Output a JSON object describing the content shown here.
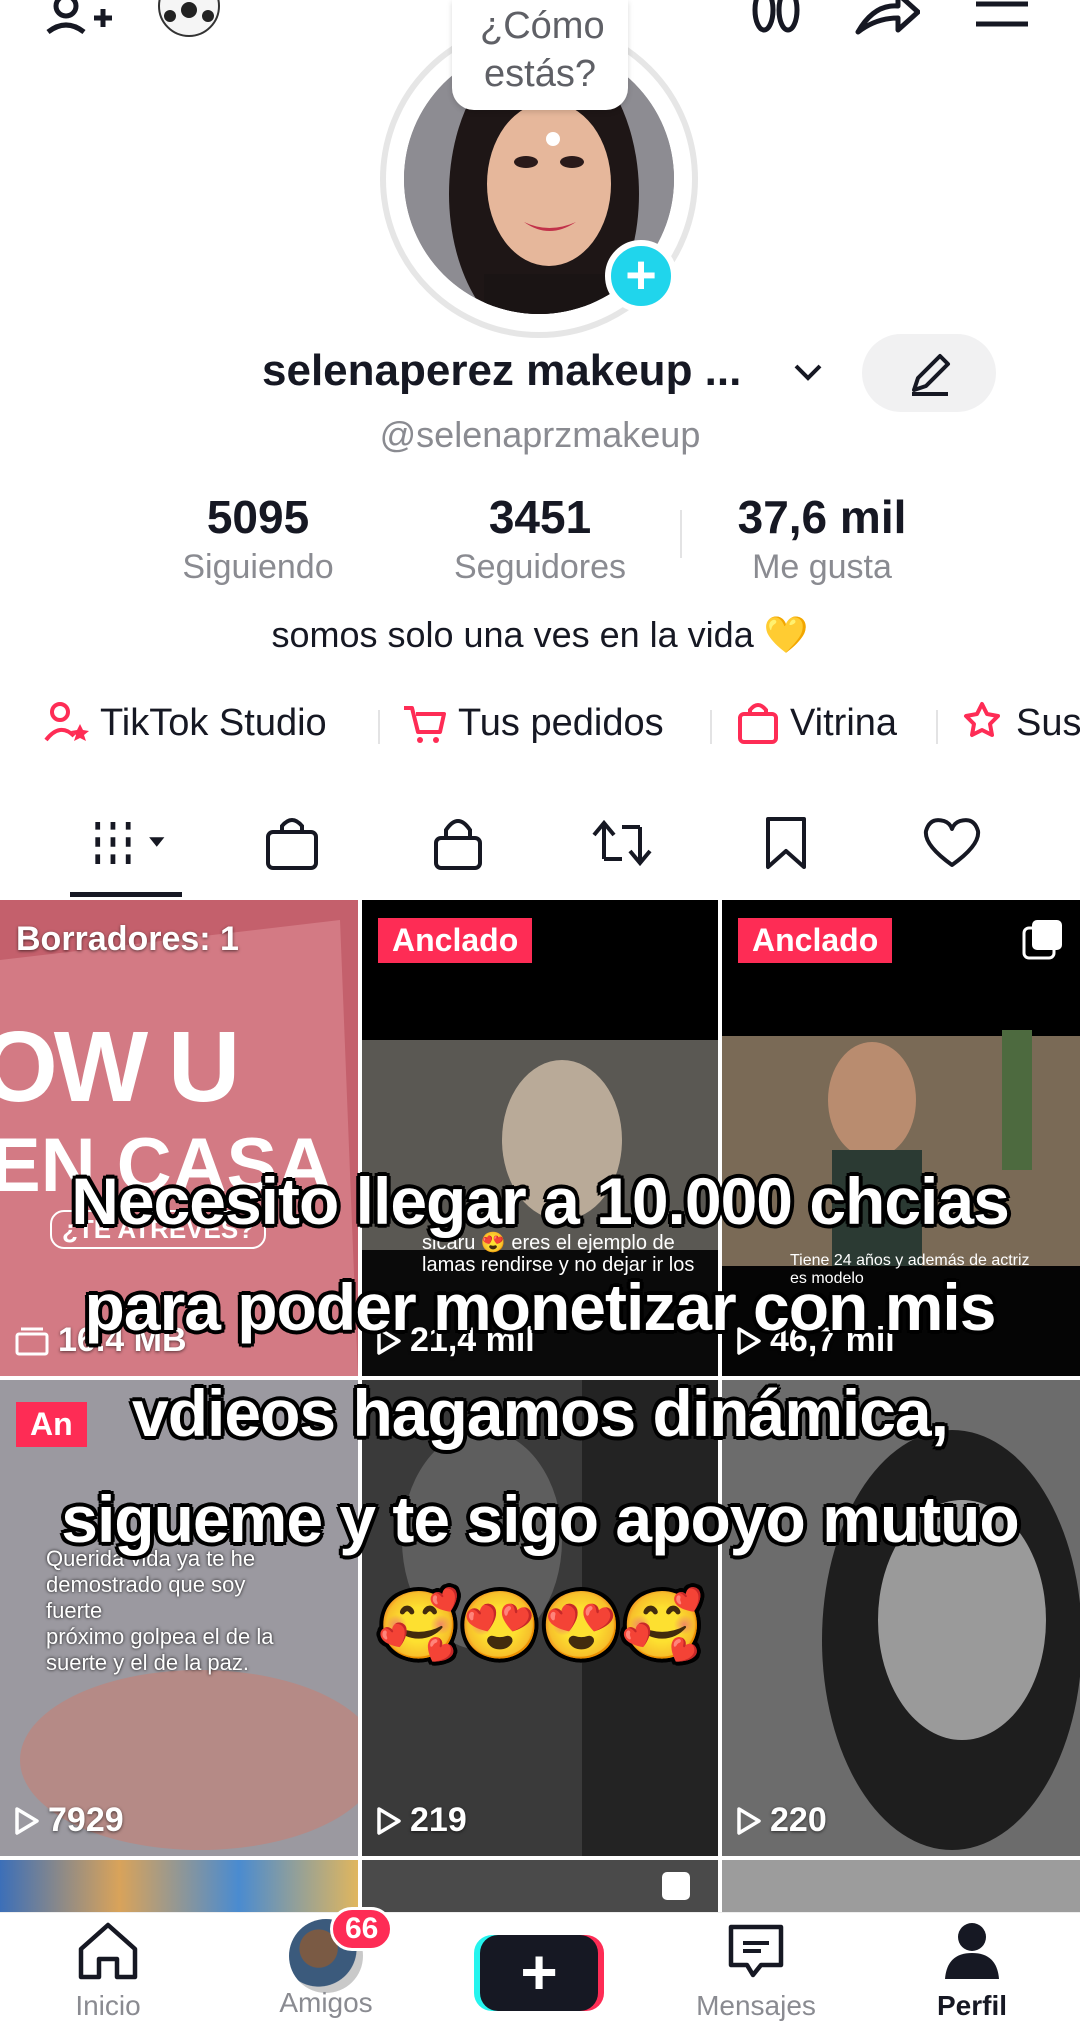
{
  "top_bar": {
    "left_icons": [
      "add-friend-icon",
      "soccer-ball-icon"
    ],
    "right_icons": [
      "footprints-icon",
      "share-icon",
      "menu-icon"
    ]
  },
  "profile": {
    "status_bubble": "¿Cómo estás?",
    "display_name": "selenaperez makeup ...",
    "handle": "@selenaprzmakeup",
    "stats": [
      {
        "value": "5095",
        "label": "Siguiendo"
      },
      {
        "value": "3451",
        "label": "Seguidores"
      },
      {
        "value": "37,6 mil",
        "label": "Me gusta"
      }
    ],
    "bio": "somos solo una ves en la vida 💛"
  },
  "links": [
    {
      "label": "TikTok Studio",
      "icon": "person-star-icon"
    },
    {
      "label": "Tus pedidos",
      "icon": "cart-icon"
    },
    {
      "label": "Vitrina",
      "icon": "shopping-bag-icon"
    },
    {
      "label": "Sus",
      "icon": "star-hand-icon"
    }
  ],
  "tabs": [
    {
      "name": "videos-tab",
      "icon": "grid-icon",
      "active": true
    },
    {
      "name": "shop-tab",
      "icon": "bag-icon"
    },
    {
      "name": "private-tab",
      "icon": "lock-icon"
    },
    {
      "name": "reposts-tab",
      "icon": "repost-icon"
    },
    {
      "name": "saved-tab",
      "icon": "bookmark-icon"
    },
    {
      "name": "liked-tab",
      "icon": "heart-icon"
    }
  ],
  "grid": [
    {
      "top_label": "Borradores: 1",
      "bottom": "16.4 MB",
      "thumb_text": [
        "OW U",
        "EN CASA",
        "¿TE ATREVES?"
      ]
    },
    {
      "badge": "Anclado",
      "bottom": "21,4 mil",
      "thumb_text": [
        "sicaru 😍 eres el ejemplo de",
        "lamas rendirse y no dejar ir los"
      ]
    },
    {
      "badge": "Anclado",
      "bottom": "46,7 mil",
      "thumb_text": [
        "Tiene 24 años y además de actriz es modelo"
      ]
    },
    {
      "badge": "An",
      "bottom": "7929",
      "thumb_text": [
        "Querida vida ya te he",
        "demostrado que soy",
        "fuerte",
        "próximo golpea el de la",
        "suerte y el de la paz."
      ]
    },
    {
      "bottom": "219"
    },
    {
      "bottom": "220"
    }
  ],
  "overlay_caption": "Necesito llegar a 10.000 chcias para poder monetizar con mis vdieos hagamos dinámica, sigueme y te sigo apoyo mutuo 🥰😍😍🥰",
  "nav": [
    {
      "label": "Inicio",
      "icon": "home-icon"
    },
    {
      "label": "Amigos",
      "icon": "friends-avatar",
      "badge": "66"
    },
    {
      "label": "+",
      "icon": "create-icon"
    },
    {
      "label": "Mensajes",
      "icon": "message-icon"
    },
    {
      "label": "Perfil",
      "icon": "profile-icon",
      "active": true
    }
  ],
  "colors": {
    "accent": "#fe2c55",
    "cyan": "#20d5ec",
    "text": "#161823",
    "muted": "#8a8b91"
  }
}
